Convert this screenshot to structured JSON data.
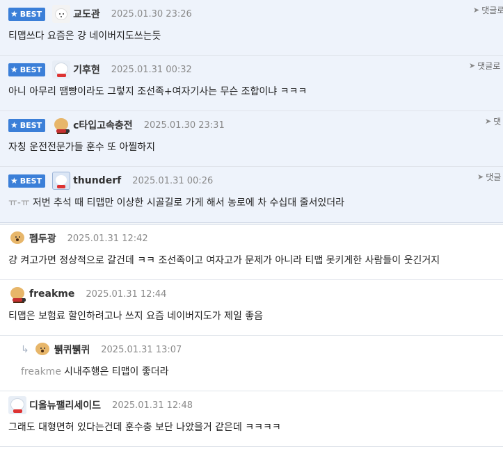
{
  "best_label": "BEST",
  "reply_label": "댓글로",
  "comments": [
    {
      "nick": "교도관",
      "date": "2025.01.30 23:26",
      "text": "티맵쓰다 요즘은 걍 네이버지도쓰는듯",
      "reply_link": "댓글로"
    },
    {
      "nick": "기후현",
      "date": "2025.01.31 00:32",
      "text": "아니 아무리 땜빵이라도 그렇지 조선족+여자기사는 무슨 조합이냐 ㅋㅋㅋ",
      "reply_link": "댓글로"
    },
    {
      "nick": "c타입고속충전",
      "date": "2025.01.30 23:31",
      "text": "자칭 운전전문가들 훈수 또 아찔하지",
      "reply_link": "댓"
    },
    {
      "nick": "thunderf",
      "date": "2025.01.31 00:26",
      "emote": "ㅠ-ㅠ",
      "text": "저번 추석 때 티맵만 이상한 시골길로 가게 해서 농로에 차 수십대 줄서있더라",
      "reply_link": "댓글"
    },
    {
      "nick": "펨두광",
      "date": "2025.01.31 12:42",
      "text": "걍 켜고가면 정상적으로 갈건데 ㅋㅋ 조선족이고 여자고가 문제가 아니라 티맵 못키게한 사람들이 웃긴거지"
    },
    {
      "nick": "freakme",
      "date": "2025.01.31 12:44",
      "text": "티맵은 보험료 할인하려고나 쓰지 요즘 네이버지도가 제일 좋음"
    },
    {
      "nick": "뷁퀴뷁퀴",
      "date": "2025.01.31 13:07",
      "mention": "freakme",
      "text": "시내주행은 티맵이 좋더라"
    },
    {
      "nick": "디올뉴팰리세이드",
      "date": "2025.01.31 12:48",
      "text": "그래도 대형면허 있다는건데 훈수충 보단 나았을거 같은데 ㅋㅋㅋㅋ"
    }
  ]
}
